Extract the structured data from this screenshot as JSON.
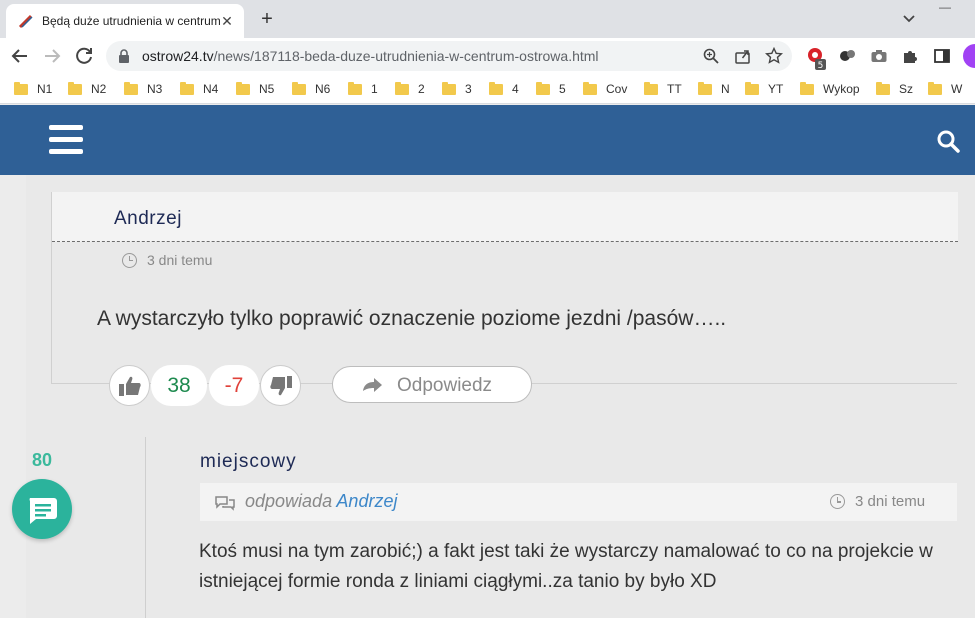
{
  "browser": {
    "tab_title": "Będą duże utrudnienia w centrum",
    "new_tab": "+",
    "url_domain": "ostrow24.tv",
    "url_path": "/news/187118-beda-duze-utrudnienia-w-centrum-ostrowa.html",
    "extension_badge": "5",
    "bookmarks": [
      "N1",
      "N2",
      "N3",
      "N4",
      "N5",
      "N6",
      "1",
      "2",
      "3",
      "4",
      "5",
      "Cov",
      "TT",
      "N",
      "YT",
      "Wykop",
      "Sz",
      "W"
    ],
    "colors": {
      "accent": "#2f6096",
      "tab_strip": "#dfe1e5"
    }
  },
  "site": {
    "header_color": "#2f6096",
    "comments": [
      {
        "author": "Andrzej",
        "time": "3 dni temu",
        "text": "A wystarczyło tylko poprawić oznaczenie poziome jezdni /pasów…..",
        "likes": "38",
        "dislikes": "-7",
        "reply_label": "Odpowiedz"
      },
      {
        "author": "miejscowy",
        "replying_prefix": "odpowiada",
        "replying_to": "Andrzej",
        "time": "3 dni temu",
        "text": "Ktoś musi na tym zarobić;) a fakt jest taki że wystarczy namalować to co na projekcie w istniejącej formie ronda z liniami ciągłymi..za tanio by było XD"
      }
    ],
    "comment_count": "80",
    "colors": {
      "likes": "#1e8a4f",
      "dislikes": "#e0413a",
      "fab": "#2bb39c",
      "author": "#1e2a55",
      "reply_link": "#3d87c9"
    }
  }
}
